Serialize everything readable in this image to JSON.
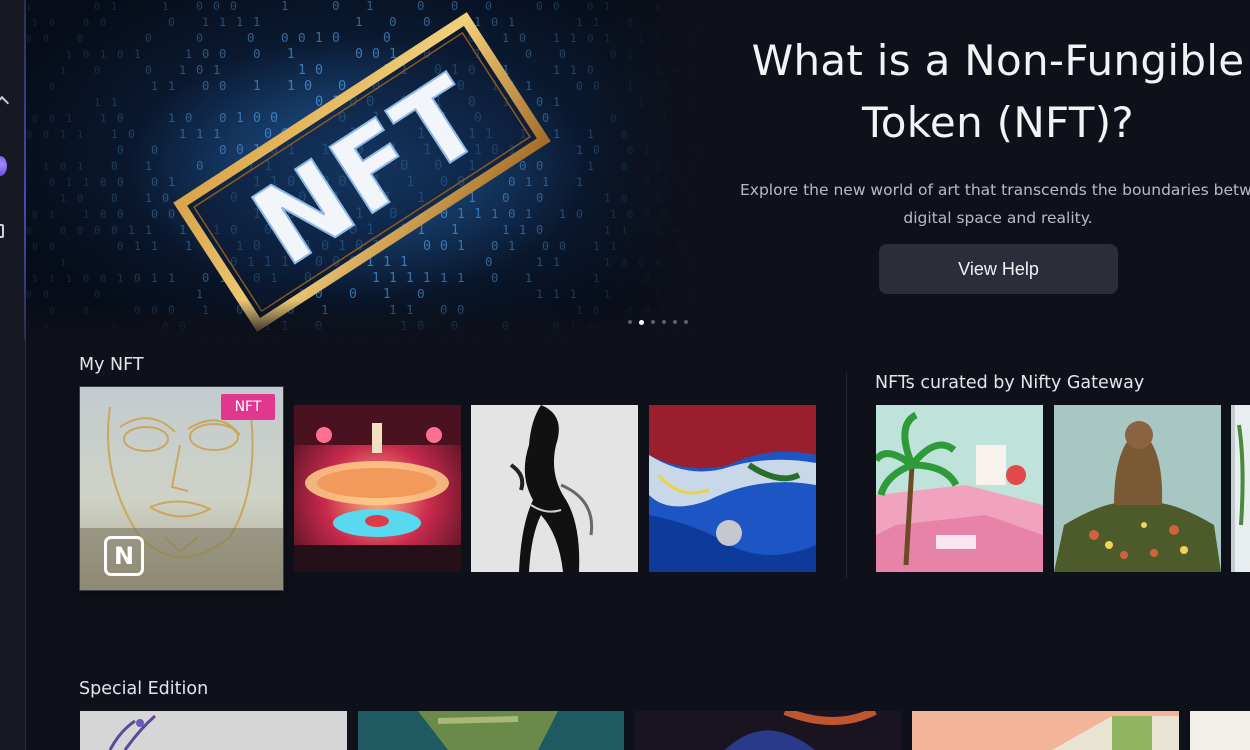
{
  "rail": {
    "icons": [
      "chevron-up-icon",
      "profile-icon",
      "window-icon"
    ]
  },
  "hero": {
    "title_line1": "What is a Non-Fungible",
    "title_line2": "Token (NFT)?",
    "desc_line1": "Explore the new world of art that transcends the boundaries between",
    "desc_line2": "digital space and reality.",
    "button_label": "View Help",
    "image_text": "NFT",
    "carousel": {
      "count": 6,
      "active_index": 1
    }
  },
  "my_nft": {
    "title": "My NFT",
    "badge": "NFT",
    "logo_letter": "N"
  },
  "curated": {
    "title": "NFTs curated by Nifty Gateway"
  },
  "special": {
    "title": "Special Edition"
  },
  "colors": {
    "background": "#0f111a",
    "badge": "#e2378f",
    "button": "#2b2e38",
    "rail_accent": "#5146b8"
  }
}
